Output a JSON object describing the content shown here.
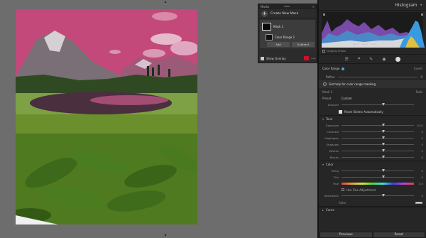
{
  "canvas": {
    "top_arrow": "▴",
    "bottom_arrow": "▾"
  },
  "masks_panel": {
    "title": "Masks",
    "create_new_mask": "Create New Mask",
    "mask_name": "Mask 1",
    "component_name": "Color Range 1",
    "add_label": "Add",
    "subtract_label": "Subtract",
    "show_overlay_label": "Show Overlay",
    "overlay_color": "#cc1030"
  },
  "right_panel": {
    "histogram_title": "Histogram",
    "histogram_values": [
      "40,0",
      "45,4",
      "42,5"
    ],
    "original_photo_label": "Original Photo",
    "color_range": {
      "label": "Color Range",
      "invert_label": "Invert",
      "refine_label": "Refine",
      "refine_value": "0"
    },
    "help_text": "Get help for color range masking",
    "mask_section": {
      "title": "Mask 1",
      "fade_label": "Fade",
      "preset_label": "Preset",
      "preset_value": "Custom",
      "amount_label": "Amount",
      "reset_label": "Reset Sliders Automatically"
    },
    "tone": {
      "title": "Tone",
      "sliders": [
        {
          "label": "Exposure",
          "value": "0,00"
        },
        {
          "label": "Contrast",
          "value": "0"
        },
        {
          "label": "Highlights",
          "value": "0"
        },
        {
          "label": "Shadows",
          "value": "0"
        },
        {
          "label": "Whites",
          "value": "0"
        },
        {
          "label": "Blacks",
          "value": "0"
        }
      ]
    },
    "color": {
      "title": "Color",
      "sliders": [
        {
          "label": "Temp",
          "value": "0"
        },
        {
          "label": "Tint",
          "value": "0"
        }
      ],
      "hue_label": "Hue",
      "hue_value": "0,0",
      "fine_adjust_label": "Use Fine Adjustment",
      "saturation_label": "Saturation",
      "saturation_value": "0",
      "color_label": "Color"
    },
    "curve_title": "Curve",
    "previous_button": "Previous",
    "reset_button": "Reset"
  }
}
